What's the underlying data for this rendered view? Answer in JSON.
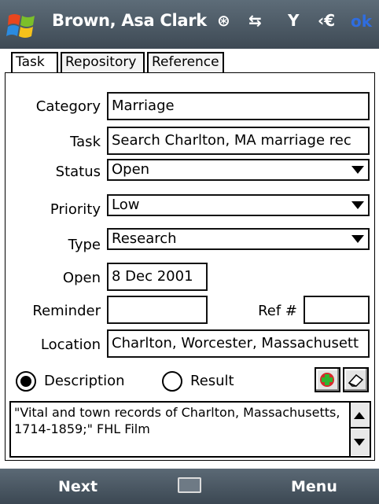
{
  "titlebar": {
    "title": "Brown, Asa Clark",
    "ok_label": "ok"
  },
  "tabs": [
    {
      "label": "Task"
    },
    {
      "label": "Repository"
    },
    {
      "label": "Reference"
    }
  ],
  "form": {
    "category": {
      "label": "Category",
      "value": "Marriage"
    },
    "task": {
      "label": "Task",
      "value": "Search Charlton, MA marriage rec"
    },
    "status": {
      "label": "Status",
      "value": "Open"
    },
    "priority": {
      "label": "Priority",
      "value": "Low"
    },
    "type": {
      "label": "Type",
      "value": "Research"
    },
    "open": {
      "label": "Open",
      "value": "8 Dec 2001"
    },
    "reminder": {
      "label": "Reminder",
      "value": ""
    },
    "ref": {
      "label": "Ref #",
      "value": ""
    },
    "location": {
      "label": "Location",
      "value": "Charlton, Worcester, Massachusett"
    }
  },
  "radios": {
    "description": {
      "label": "Description",
      "selected": true
    },
    "result": {
      "label": "Result",
      "selected": false
    }
  },
  "description_text": "\"Vital and town records of Charlton, Massachusetts, 1714-1859;\" FHL Film",
  "softkeys": {
    "left": "Next",
    "right": "Menu"
  },
  "icons": [
    "windows-start-icon",
    "bluetooth-icon",
    "sync-arrows-icon",
    "signal-icon",
    "volume-icon",
    "add-green-icon",
    "eraser-icon",
    "keyboard-icon"
  ]
}
